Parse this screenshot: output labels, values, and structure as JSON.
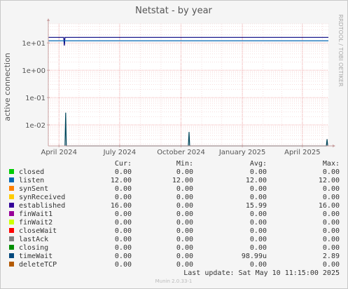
{
  "chart_data": {
    "type": "line",
    "title": "Netstat - by year",
    "ylabel": "active connection",
    "watermark": "RRDTOOL / TOBI OETIKER",
    "footer": "Munin 2.0.33-1",
    "y_scale": "log",
    "y_ticks": [
      "1e+01",
      "1e+00",
      "1e-01",
      "1e-02"
    ],
    "y_tick_values": [
      10,
      1,
      0.1,
      0.01
    ],
    "ylim": [
      0.0017,
      50
    ],
    "x_ticks": [
      "April 2024",
      "July 2024",
      "October 2024",
      "January 2025",
      "April 2025"
    ],
    "x_tick_dates": [
      "2024-04-01",
      "2024-07-01",
      "2024-10-01",
      "2025-01-01",
      "2025-04-01"
    ],
    "xlim": [
      "2024-03-16",
      "2025-05-10"
    ],
    "grid": true,
    "series": [
      {
        "name": "established",
        "color": "#000080",
        "x": [
          "2024-03-16",
          "2024-04-08",
          "2024-04-09",
          "2024-04-10",
          "2024-04-11",
          "2025-05-10"
        ],
        "values": [
          16,
          16,
          8,
          16,
          16,
          16
        ]
      },
      {
        "name": "listen",
        "color": "#0066b3",
        "x": [
          "2024-03-16",
          "2025-05-10"
        ],
        "values": [
          12,
          12
        ]
      },
      {
        "name": "timeWait",
        "color": "#00455a",
        "x": [
          "2024-04-10",
          "2024-04-11",
          "2024-04-12",
          "2024-10-12",
          "2024-10-13",
          "2024-10-14",
          "2025-05-07",
          "2025-05-08",
          "2025-05-09"
        ],
        "values": [
          0,
          0.028,
          0,
          0,
          0.0055,
          0,
          0,
          0.003,
          0
        ]
      }
    ]
  },
  "legend": {
    "headers": {
      "cur": "Cur:",
      "min": "Min:",
      "avg": "Avg:",
      "max": "Max:"
    },
    "rows": [
      {
        "name": "closed",
        "color": "#00cc00",
        "cur": "0.00",
        "min": "0.00",
        "avg": "0.00",
        "max": "0.00"
      },
      {
        "name": "listen",
        "color": "#0066b3",
        "cur": "12.00",
        "min": "12.00",
        "avg": "12.00",
        "max": "12.00"
      },
      {
        "name": "synSent",
        "color": "#ff8000",
        "cur": "0.00",
        "min": "0.00",
        "avg": "0.00",
        "max": "0.00"
      },
      {
        "name": "synReceived",
        "color": "#ffcc00",
        "cur": "0.00",
        "min": "0.00",
        "avg": "0.00",
        "max": "0.00"
      },
      {
        "name": "established",
        "color": "#330099",
        "cur": "16.00",
        "min": "0.00",
        "avg": "15.99",
        "max": "16.00"
      },
      {
        "name": "finWait1",
        "color": "#990099",
        "cur": "0.00",
        "min": "0.00",
        "avg": "0.00",
        "max": "0.00"
      },
      {
        "name": "finWait2",
        "color": "#ccff00",
        "cur": "0.00",
        "min": "0.00",
        "avg": "0.00",
        "max": "0.00"
      },
      {
        "name": "closeWait",
        "color": "#ff0000",
        "cur": "0.00",
        "min": "0.00",
        "avg": "0.00",
        "max": "0.00"
      },
      {
        "name": "lastAck",
        "color": "#808080",
        "cur": "0.00",
        "min": "0.00",
        "avg": "0.00",
        "max": "0.00"
      },
      {
        "name": "closing",
        "color": "#008f00",
        "cur": "0.00",
        "min": "0.00",
        "avg": "0.00",
        "max": "0.00"
      },
      {
        "name": "timeWait",
        "color": "#00487d",
        "cur": "0.00",
        "min": "0.00",
        "avg": "98.99u",
        "max": "2.89"
      },
      {
        "name": "deleteTCP",
        "color": "#b35a00",
        "cur": "0.00",
        "min": "0.00",
        "avg": "0.00",
        "max": "0.00"
      }
    ],
    "last_update": "Last update:  Sat May 10 11:15:00 2025"
  }
}
